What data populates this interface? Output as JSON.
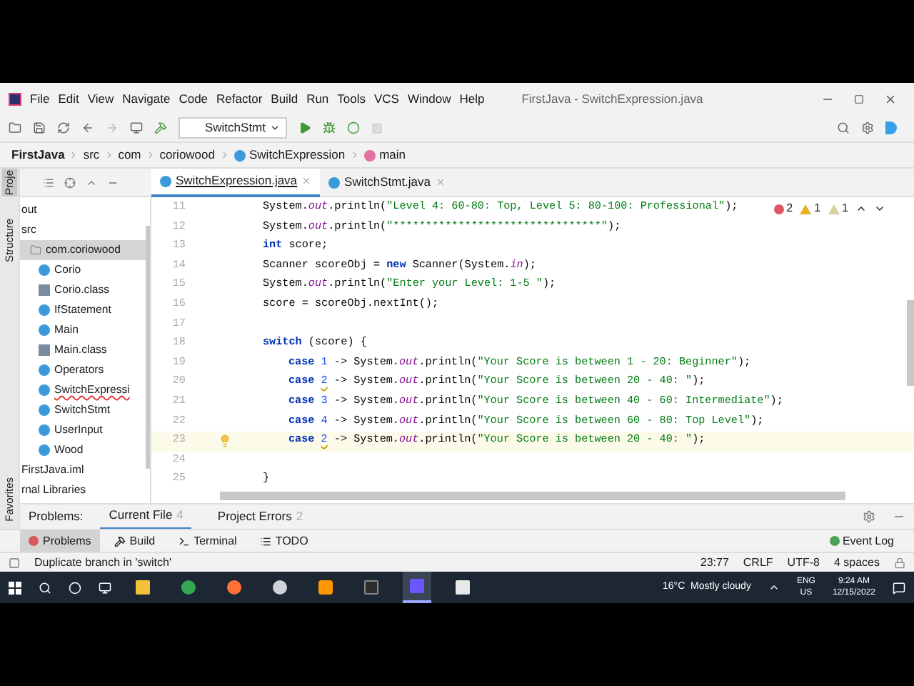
{
  "window": {
    "title": "FirstJava - SwitchExpression.java"
  },
  "menu": [
    "File",
    "Edit",
    "View",
    "Navigate",
    "Code",
    "Refactor",
    "Build",
    "Run",
    "Tools",
    "VCS",
    "Window",
    "Help"
  ],
  "toolbar": {
    "run_config": "SwitchStmt"
  },
  "breadcrumbs": [
    {
      "label": "FirstJava",
      "kind": "project"
    },
    {
      "label": "src",
      "kind": "folder"
    },
    {
      "label": "com",
      "kind": "folder"
    },
    {
      "label": "coriowood",
      "kind": "folder"
    },
    {
      "label": "SwitchExpression",
      "kind": "class"
    },
    {
      "label": "main",
      "kind": "method"
    }
  ],
  "side_tabs": [
    {
      "label": "Proje",
      "selected": true
    },
    {
      "label": "Structure",
      "selected": false
    },
    {
      "label": "Favorites",
      "selected": false
    }
  ],
  "editor_tabs": [
    {
      "label": "SwitchExpression.java",
      "selected": true
    },
    {
      "label": "SwitchStmt.java",
      "selected": false
    }
  ],
  "project_tree": [
    {
      "label": "out",
      "selected": false
    },
    {
      "label": "src",
      "selected": false,
      "children": [
        {
          "label": "com.coriowood",
          "kind": "package",
          "selected": true,
          "error": false,
          "children": [
            {
              "label": "Corio",
              "kind": "class",
              "selected": false,
              "error": false
            },
            {
              "label": "Corio.class",
              "kind": "classfile",
              "selected": false,
              "error": false
            },
            {
              "label": "IfStatement",
              "kind": "class",
              "selected": false,
              "error": false
            },
            {
              "label": "Main",
              "kind": "class",
              "selected": false,
              "error": false
            },
            {
              "label": "Main.class",
              "kind": "classfile",
              "selected": false,
              "error": false
            },
            {
              "label": "Operators",
              "kind": "class",
              "selected": false,
              "error": false
            },
            {
              "label": "SwitchExpressi",
              "kind": "class",
              "selected": false,
              "error": true
            },
            {
              "label": "SwitchStmt",
              "kind": "class",
              "selected": false,
              "error": false
            },
            {
              "label": "UserInput",
              "kind": "class",
              "selected": false,
              "error": false
            },
            {
              "label": "Wood",
              "kind": "class",
              "selected": false,
              "error": false
            }
          ]
        }
      ]
    },
    {
      "label": "FirstJava.iml",
      "selected": false
    },
    {
      "label": "rnal Libraries",
      "selected": false
    }
  ],
  "inspections": {
    "errors": "2",
    "warnings": "1",
    "weak_warnings": "1"
  },
  "code_lines": [
    {
      "number": "11",
      "current": false,
      "indented": false,
      "tokens": [
        {
          "text": "System.",
          "kind": "plain"
        },
        {
          "text": "out",
          "kind": "static"
        },
        {
          "text": ".println(",
          "kind": "plain"
        },
        {
          "text": "\"Level 4: 60-80: Top, Level 5: 80-100: Professional\"",
          "kind": "string"
        },
        {
          "text": ");",
          "kind": "plain"
        }
      ]
    },
    {
      "number": "12",
      "current": false,
      "indented": false,
      "tokens": [
        {
          "text": "System.",
          "kind": "plain"
        },
        {
          "text": "out",
          "kind": "static"
        },
        {
          "text": ".println(",
          "kind": "plain"
        },
        {
          "text": "\"********************************\"",
          "kind": "string"
        },
        {
          "text": ");",
          "kind": "plain"
        }
      ]
    },
    {
      "number": "13",
      "current": false,
      "indented": false,
      "tokens": [
        {
          "text": "int",
          "kind": "keyword"
        },
        {
          "text": " score;",
          "kind": "plain"
        }
      ]
    },
    {
      "number": "14",
      "current": false,
      "indented": false,
      "tokens": [
        {
          "text": "Scanner scoreObj = ",
          "kind": "plain"
        },
        {
          "text": "new",
          "kind": "keyword"
        },
        {
          "text": " Scanner(System.",
          "kind": "plain"
        },
        {
          "text": "in",
          "kind": "static"
        },
        {
          "text": ");",
          "kind": "plain"
        }
      ]
    },
    {
      "number": "15",
      "current": false,
      "indented": false,
      "tokens": [
        {
          "text": "System.",
          "kind": "plain"
        },
        {
          "text": "out",
          "kind": "static"
        },
        {
          "text": ".println(",
          "kind": "plain"
        },
        {
          "text": "\"Enter your Level: 1-5 \"",
          "kind": "string"
        },
        {
          "text": ");",
          "kind": "plain"
        }
      ]
    },
    {
      "number": "16",
      "current": false,
      "indented": false,
      "tokens": [
        {
          "text": "score = scoreObj.nextInt();",
          "kind": "plain"
        }
      ]
    },
    {
      "number": "17",
      "current": false
    },
    {
      "number": "18",
      "current": false,
      "indented": false,
      "tokens": [
        {
          "text": "switch",
          "kind": "keyword"
        },
        {
          "text": " (score) {",
          "kind": "plain"
        }
      ]
    },
    {
      "number": "19",
      "current": false,
      "indented": true,
      "tokens": [
        {
          "text": "case ",
          "kind": "keyword"
        },
        {
          "text": "1",
          "kind": "number"
        },
        {
          "text": " -> System.",
          "kind": "plain"
        },
        {
          "text": "out",
          "kind": "static"
        },
        {
          "text": ".println(",
          "kind": "plain"
        },
        {
          "text": "\"Your Score is between 1 - 20: Beginner\"",
          "kind": "string"
        },
        {
          "text": ");",
          "kind": "plain"
        }
      ]
    },
    {
      "number": "20",
      "current": false,
      "indented": true,
      "tokens": [
        {
          "text": "case ",
          "kind": "keyword"
        },
        {
          "text": "2",
          "kind": "duplicate"
        },
        {
          "text": " -> System.",
          "kind": "plain"
        },
        {
          "text": "out",
          "kind": "static"
        },
        {
          "text": ".println(",
          "kind": "plain"
        },
        {
          "text": "\"Your Score is between 20 - 40: \"",
          "kind": "string"
        },
        {
          "text": ");",
          "kind": "plain"
        }
      ]
    },
    {
      "number": "21",
      "current": false,
      "indented": true,
      "tokens": [
        {
          "text": "case ",
          "kind": "keyword"
        },
        {
          "text": "3",
          "kind": "number"
        },
        {
          "text": " -> System.",
          "kind": "plain"
        },
        {
          "text": "out",
          "kind": "static"
        },
        {
          "text": ".println(",
          "kind": "plain"
        },
        {
          "text": "\"Your Score is between 40 - 60: Intermediate\"",
          "kind": "string"
        },
        {
          "text": ");",
          "kind": "plain"
        }
      ]
    },
    {
      "number": "22",
      "current": false,
      "indented": true,
      "tokens": [
        {
          "text": "case ",
          "kind": "keyword"
        },
        {
          "text": "4",
          "kind": "number"
        },
        {
          "text": " -> System.",
          "kind": "plain"
        },
        {
          "text": "out",
          "kind": "static"
        },
        {
          "text": ".println(",
          "kind": "plain"
        },
        {
          "text": "\"Your Score is between 60 - 80: Top Level\"",
          "kind": "string"
        },
        {
          "text": ");",
          "kind": "plain"
        }
      ]
    },
    {
      "number": "23",
      "current": true,
      "indented": true,
      "tokens": [
        {
          "text": "case ",
          "kind": "keyword"
        },
        {
          "text": "2",
          "kind": "duplicate"
        },
        {
          "text": " -> System.",
          "kind": "plain"
        },
        {
          "text": "out",
          "kind": "static"
        },
        {
          "text": ".println(",
          "kind": "plain"
        },
        {
          "text": "\"Your Score is between 20 - 40: \"",
          "kind": "string"
        },
        {
          "text": ");",
          "kind": "plain"
        }
      ]
    },
    {
      "number": "24",
      "current": false
    },
    {
      "number": "25",
      "current": false,
      "indented": false,
      "tokens": [
        {
          "text": "}",
          "kind": "plain"
        }
      ]
    }
  ],
  "problems": {
    "label": "Problems:",
    "tabs": [
      {
        "label": "Current File",
        "count": "4",
        "selected": true
      },
      {
        "label": "Project Errors",
        "count": "2",
        "selected": false
      }
    ]
  },
  "tool_windows": [
    {
      "label": "Problems",
      "kind": "problems",
      "selected": true
    },
    {
      "label": "Build",
      "kind": "build",
      "selected": false
    },
    {
      "label": "Terminal",
      "kind": "terminal",
      "selected": false
    },
    {
      "label": "TODO",
      "kind": "todo",
      "selected": false
    }
  ],
  "event_log": "Event Log",
  "status_bar": {
    "message": "Duplicate branch in 'switch'",
    "position": "23:77",
    "line_separator": "CRLF",
    "encoding": "UTF-8",
    "indent": "4 spaces"
  },
  "taskbar": {
    "apps": [
      {
        "kind": "explorer",
        "selected": false
      },
      {
        "kind": "chrome",
        "selected": false
      },
      {
        "kind": "firefox",
        "selected": false
      },
      {
        "kind": "settings",
        "selected": false
      },
      {
        "kind": "sublime",
        "selected": false
      },
      {
        "kind": "terminal",
        "selected": false
      },
      {
        "kind": "intellij",
        "selected": true
      },
      {
        "kind": "snip",
        "selected": false
      }
    ],
    "weather": "16°C  Mostly cloudy",
    "language": "ENG",
    "region": "US",
    "time": "9:24 AM",
    "date": "12/15/2022"
  }
}
